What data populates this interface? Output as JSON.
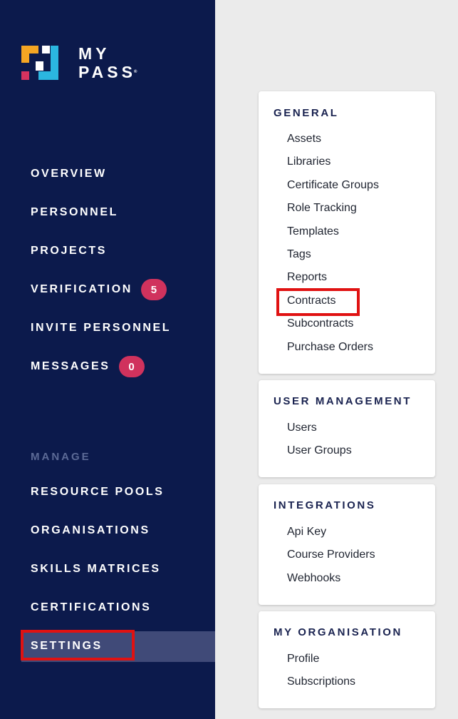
{
  "brand": {
    "line1": "MY",
    "line2": "PASS",
    "mark": "®"
  },
  "nav": {
    "overview": "OVERVIEW",
    "personnel": "PERSONNEL",
    "projects": "PROJECTS",
    "verification": {
      "label": "VERIFICATION",
      "count": "5"
    },
    "invite": "INVITE PERSONNEL",
    "messages": {
      "label": "MESSAGES",
      "count": "0"
    }
  },
  "manage": {
    "heading": "MANAGE",
    "items": [
      "RESOURCE POOLS",
      "ORGANISATIONS",
      "SKILLS MATRICES",
      "CERTIFICATIONS",
      "SETTINGS"
    ]
  },
  "settings_cards": [
    {
      "title": "GENERAL",
      "links": [
        "Assets",
        "Libraries",
        "Certificate Groups",
        "Role Tracking",
        "Templates",
        "Tags",
        "Reports",
        "Contracts",
        "Subcontracts",
        "Purchase Orders"
      ]
    },
    {
      "title": "USER MANAGEMENT",
      "links": [
        "Users",
        "User Groups"
      ]
    },
    {
      "title": "INTEGRATIONS",
      "links": [
        "Api Key",
        "Course Providers",
        "Webhooks"
      ]
    },
    {
      "title": "MY ORGANISATION",
      "links": [
        "Profile",
        "Subscriptions"
      ]
    }
  ],
  "colors": {
    "sidebar": "#0c1a4c",
    "badge": "#d0325d",
    "highlight": "#e01212",
    "active_item": "#404a78",
    "logo_orange": "#f5a623",
    "logo_pink": "#d6335f",
    "logo_cyan": "#2bb6e0"
  }
}
